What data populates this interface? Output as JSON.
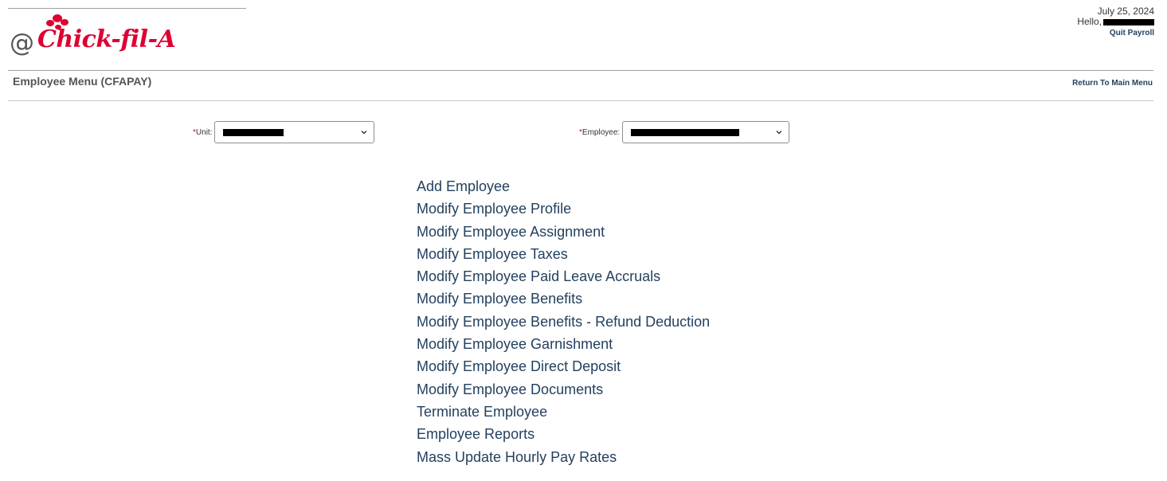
{
  "brand": {
    "at_symbol": "@",
    "logo_text": "Chick-fil-A",
    "logo_color": "#dd0031"
  },
  "header": {
    "date": "July 25, 2024",
    "greeting": "Hello,",
    "quit_label": "Quit Payroll"
  },
  "page": {
    "title": "Employee Menu (CFAPAY)",
    "return_label": "Return To Main Menu"
  },
  "filters": {
    "required_marker": "*",
    "unit_label": "Unit:",
    "employee_label": "Employee:"
  },
  "menu": {
    "items": [
      "Add Employee",
      "Modify Employee Profile",
      "Modify Employee Assignment",
      "Modify Employee Taxes",
      "Modify Employee Paid Leave Accruals",
      "Modify Employee Benefits",
      "Modify Employee Benefits - Refund Deduction",
      "Modify Employee Garnishment",
      "Modify Employee Direct Deposit",
      "Modify Employee Documents",
      "Terminate Employee",
      "Employee Reports",
      "Mass Update Hourly Pay Rates"
    ]
  },
  "colors": {
    "link": "#23415f",
    "required": "#c8102e",
    "redaction": "#000000"
  },
  "icons": {
    "dropdown": "chevron-down-icon"
  }
}
